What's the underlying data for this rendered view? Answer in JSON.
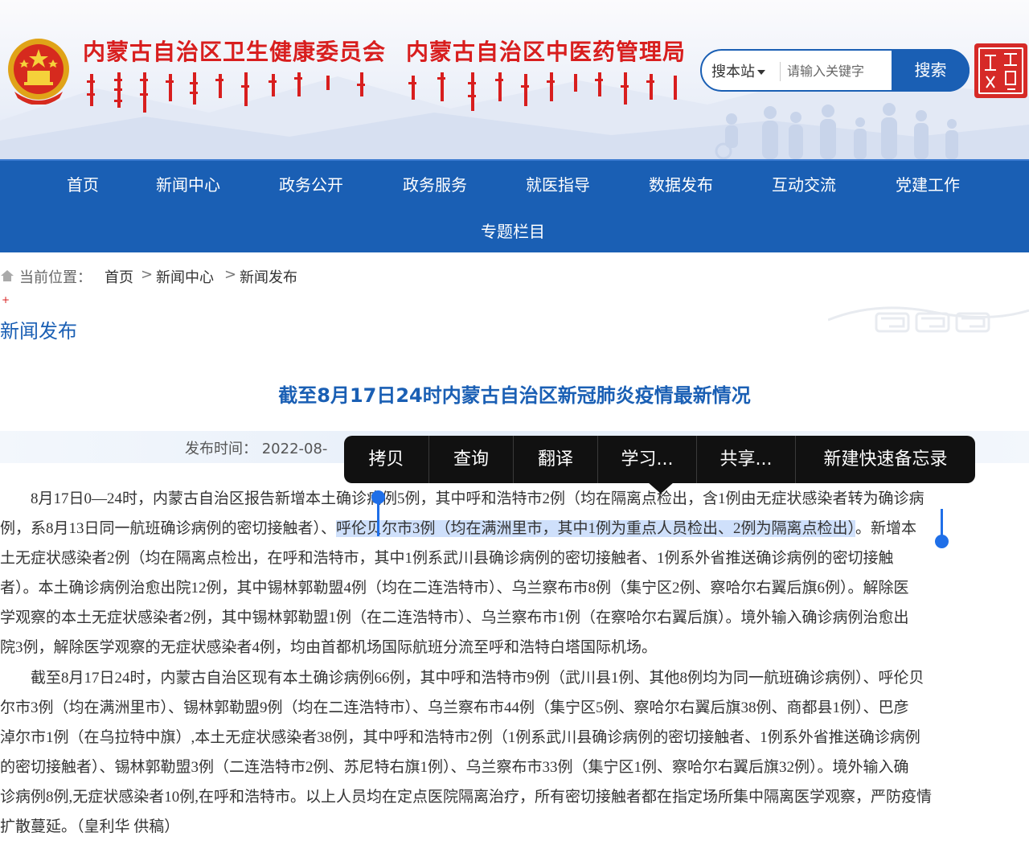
{
  "header": {
    "title_left": "内蒙古自治区卫生健康委员会",
    "title_right": "内蒙古自治区中医药管理局",
    "search": {
      "scope": "搜本站",
      "placeholder": "请输入关键字",
      "button": "搜索"
    }
  },
  "nav": {
    "items": [
      "首页",
      "新闻中心",
      "政务公开",
      "政务服务",
      "就医指导",
      "数据发布",
      "互动交流",
      "党建工作"
    ],
    "second_row": "专题栏目"
  },
  "breadcrumb": {
    "label": "当前位置：",
    "items": [
      "首页",
      "新闻中心",
      "新闻发布"
    ],
    "sep": ">"
  },
  "section_title": "新闻发布",
  "article": {
    "title": "截至8月17日24时内蒙古自治区新冠肺炎疫情最新情况",
    "meta": "发布时间：  2022-08-",
    "para1": [
      "8月17日0—24时，内蒙古自治区报告新增本土确诊病例5例，其中呼和浩特市2例（均在隔离点检出，含1例由无症状感染者转为确诊病",
      "例，系8月13日同一航班确诊病例的密切接触者）、",
      "呼伦贝尔市3例（均在满洲里市，其中1例为重点人员检出、2例为隔离点检出）",
      "。新增本",
      "土无症状感染者2例（均在隔离点检出，在呼和浩特市，其中1例系武川县确诊病例的密切接触者、1例系外省推送确诊病例的密切接触",
      "者）。本土确诊病例治愈出院12例，其中锡林郭勒盟4例（均在二连浩特市）、乌兰察布市8例（集宁区2例、察哈尔右翼后旗6例）。解除医",
      "学观察的本土无症状感染者2例，其中锡林郭勒盟1例（在二连浩特市）、乌兰察布市1例（在察哈尔右翼后旗）。境外输入确诊病例治愈出",
      "院3例，解除医学观察的无症状感染者4例，均由首都机场国际航班分流至呼和浩特白塔国际机场。"
    ],
    "para2": [
      "截至8月17日24时，内蒙古自治区现有本土确诊病例66例，其中呼和浩特市9例（武川县1例、其他8例均为同一航班确诊病例）、呼伦贝",
      "尔市3例（均在满洲里市）、锡林郭勒盟9例（均在二连浩特市）、乌兰察布市44例（集宁区5例、察哈尔右翼后旗38例、商都县1例）、巴彦",
      "淖尔市1例（在乌拉特中旗）,本土无症状感染者38例，其中呼和浩特市2例（1例系武川县确诊病例的密切接触者、1例系外省推送确诊病例",
      "的密切接触者）、锡林郭勒盟3例（二连浩特市2例、苏尼特右旗1例）、乌兰察布市33例（集宁区1例、察哈尔右翼后旗32例）。境外输入确",
      "诊病例8例,无症状感染者10例,在呼和浩特市。以上人员均在定点医院隔离治疗，所有密切接触者都在指定场所集中隔离医学观察，严防疫情",
      "扩散蔓延。（皇利华 供稿）"
    ]
  },
  "context_menu": {
    "items": [
      "拷贝",
      "查询",
      "翻译",
      "学习...",
      "共享...",
      "新建快速备忘录"
    ]
  },
  "colors": {
    "brand_blue": "#1a5fb4",
    "title_red": "#d81e1e",
    "selection": "#cfe0fb",
    "handle_blue": "#1f6fe8"
  }
}
